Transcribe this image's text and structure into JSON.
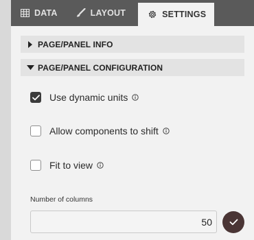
{
  "tabs": [
    {
      "label": "DATA",
      "icon": "table-icon"
    },
    {
      "label": "LAYOUT",
      "icon": "brush-icon"
    },
    {
      "label": "SETTINGS",
      "icon": "gear-icon",
      "active": true
    }
  ],
  "sections": {
    "info": {
      "title": "PAGE/PANEL INFO",
      "expanded": false
    },
    "config": {
      "title": "PAGE/PANEL CONFIGURATION",
      "expanded": true
    }
  },
  "options": {
    "dynamic_units": {
      "label": "Use dynamic units",
      "checked": true
    },
    "components_shift": {
      "label": "Allow components to shift",
      "checked": false
    },
    "fit_to_view": {
      "label": "Fit to view",
      "checked": false
    }
  },
  "columns": {
    "label": "Number of columns",
    "value": "50"
  },
  "colors": {
    "tabbar": "#5a5a5a",
    "confirm_button": "#4a3535",
    "checked_box": "#3b3b3b"
  }
}
